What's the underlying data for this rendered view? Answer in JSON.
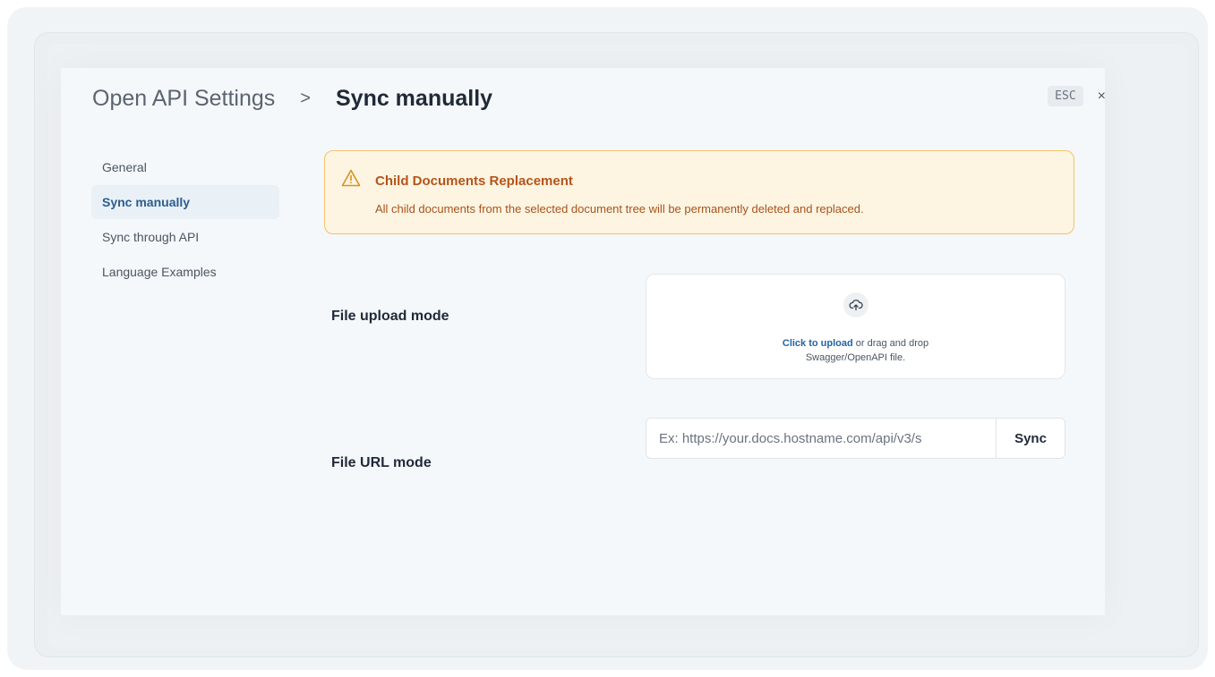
{
  "breadcrumb": {
    "root": "Open API Settings",
    "separator": ">",
    "current": "Sync manually"
  },
  "header": {
    "esc_label": "ESC",
    "close_glyph": "×"
  },
  "sidebar": {
    "items": [
      {
        "label": "General",
        "active": false
      },
      {
        "label": "Sync manually",
        "active": true
      },
      {
        "label": "Sync through API",
        "active": false
      },
      {
        "label": "Language Examples",
        "active": false
      }
    ]
  },
  "alert": {
    "icon": "warning-triangle-icon",
    "title": "Child Documents Replacement",
    "body": "All child documents from the selected document tree will be permanently deleted and replaced."
  },
  "upload": {
    "label": "File upload mode",
    "icon": "cloud-upload-icon",
    "link_text": "Click to upload",
    "rest_text": " or drag and drop",
    "second_line": "Swagger/OpenAPI file."
  },
  "url": {
    "label": "File URL mode",
    "placeholder": "Ex: https://your.docs.hostname.com/api/v3/s",
    "button_label": "Sync"
  },
  "colors": {
    "accent": "#2563a8",
    "warning_border": "#f2c46a",
    "warning_bg": "#fdf5e2",
    "warning_text": "#b5541a"
  }
}
